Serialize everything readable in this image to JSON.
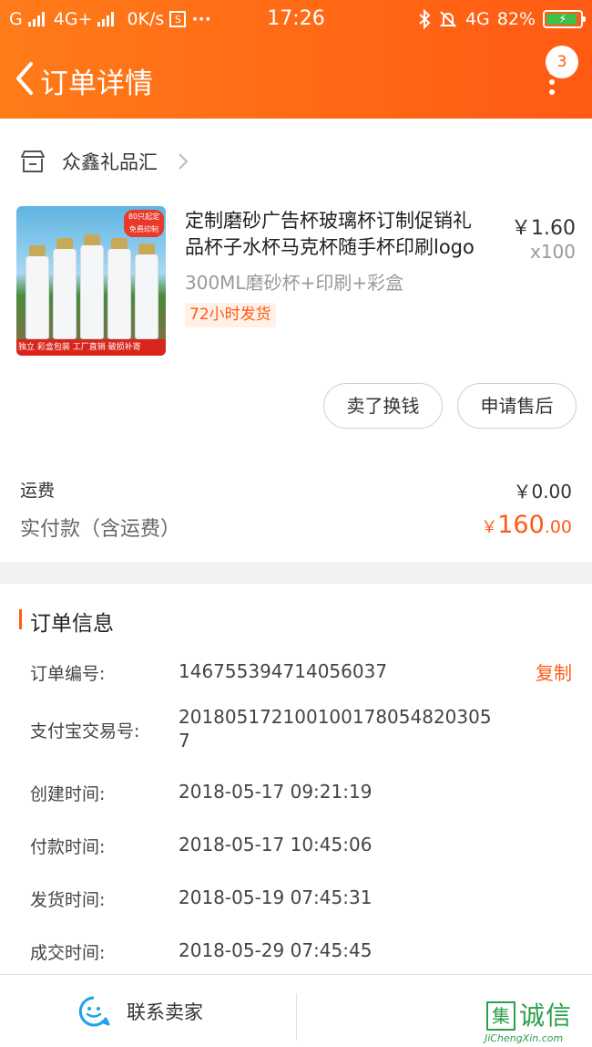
{
  "status_bar": {
    "carrier1": "G",
    "carrier2": "4G+",
    "speed": "0K/s",
    "sim_icon": "S",
    "dots": "···",
    "time": "17:26",
    "network": "4G",
    "battery": "82%",
    "battery_level": 0.82
  },
  "nav": {
    "title": "订单详情",
    "message_count": "3"
  },
  "shop": {
    "name": "众鑫礼品汇"
  },
  "product": {
    "title": "定制磨砂广告杯玻璃杯订制促销礼品杯子水杯马克杯随手杯印刷logo",
    "price": "￥1.60",
    "quantity": "x100",
    "spec": "300ML磨砂杯+印刷+彩盒",
    "ship_tag": "72小时发货",
    "image_badge": "80只起定 免费印制",
    "image_strip": "独立 彩盒包装 工厂直销 破损补寄"
  },
  "actions": {
    "resell": "卖了换钱",
    "after_sale": "申请售后"
  },
  "summary": {
    "shipping_label": "运费",
    "shipping_value": "￥0.00",
    "paid_label": "实付款（含运费）",
    "paid_currency": "￥",
    "paid_integer": "160",
    "paid_decimal": ".00"
  },
  "order_info": {
    "title": "订单信息",
    "copy_label": "复制",
    "rows": [
      {
        "label": "订单编号:",
        "value": "146755394714056037"
      },
      {
        "label": "支付宝交易号:",
        "value": "2018051721001001780548203057"
      },
      {
        "label": "创建时间:",
        "value": "2018-05-17 09:21:19"
      },
      {
        "label": "付款时间:",
        "value": "2018-05-17 10:45:06"
      },
      {
        "label": "发货时间:",
        "value": "2018-05-19 07:45:31"
      },
      {
        "label": "成交时间:",
        "value": "2018-05-29 07:45:45"
      }
    ]
  },
  "bottom": {
    "contact_seller": "联系卖家"
  },
  "watermark": {
    "box": "集",
    "text": "诚信",
    "url": "JiChengXin.com"
  },
  "colors": {
    "accent": "#ff5a14",
    "header_start": "#ff7b18",
    "service_icon": "#1fa3e8",
    "watermark": "#2aa04a"
  },
  "icons": [
    "signal-icon",
    "sim-card-icon",
    "bluetooth-icon",
    "mute-bell-icon",
    "battery-icon",
    "back-arrow-icon",
    "more-dots-icon",
    "store-icon",
    "chevron-right-icon",
    "customer-service-icon"
  ]
}
